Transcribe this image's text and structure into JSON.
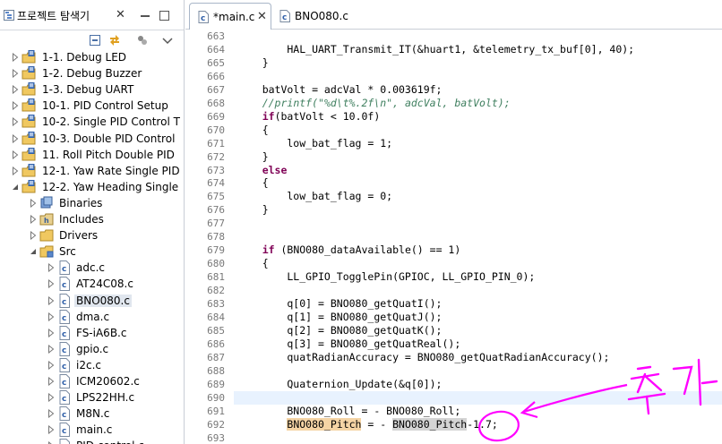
{
  "explorer": {
    "title": "프로젝트 탐색기",
    "close_glyph": "✕",
    "items": [
      {
        "label": "1-1. Debug LED",
        "depth": 0,
        "arrow": "right",
        "icon": "project-icon"
      },
      {
        "label": "1-2. Debug Buzzer",
        "depth": 0,
        "arrow": "right",
        "icon": "project-icon"
      },
      {
        "label": "1-3. Debug UART",
        "depth": 0,
        "arrow": "right",
        "icon": "project-icon"
      },
      {
        "label": "10-1. PID Control Setup",
        "depth": 0,
        "arrow": "right",
        "icon": "project-icon"
      },
      {
        "label": "10-2. Single PID Control T",
        "depth": 0,
        "arrow": "right",
        "icon": "project-icon"
      },
      {
        "label": "10-3. Double PID Control",
        "depth": 0,
        "arrow": "right",
        "icon": "project-icon"
      },
      {
        "label": "11. Roll Pitch Double PID",
        "depth": 0,
        "arrow": "right",
        "icon": "project-icon"
      },
      {
        "label": "12-1. Yaw Rate Single PID",
        "depth": 0,
        "arrow": "right",
        "icon": "project-icon"
      },
      {
        "label": "12-2. Yaw Heading Single",
        "depth": 0,
        "arrow": "down",
        "icon": "project-icon"
      },
      {
        "label": "Binaries",
        "depth": 1,
        "arrow": "right",
        "icon": "binaries-icon"
      },
      {
        "label": "Includes",
        "depth": 1,
        "arrow": "right",
        "icon": "includes-icon"
      },
      {
        "label": "Drivers",
        "depth": 1,
        "arrow": "right",
        "icon": "folder-icon"
      },
      {
        "label": "Src",
        "depth": 1,
        "arrow": "down",
        "icon": "source-folder-icon"
      },
      {
        "label": "adc.c",
        "depth": 2,
        "arrow": "right",
        "icon": "c-file-icon"
      },
      {
        "label": "AT24C08.c",
        "depth": 2,
        "arrow": "right",
        "icon": "c-file-icon"
      },
      {
        "label": "BNO080.c",
        "depth": 2,
        "arrow": "right",
        "icon": "c-file-icon",
        "selected": true
      },
      {
        "label": "dma.c",
        "depth": 2,
        "arrow": "right",
        "icon": "c-file-icon"
      },
      {
        "label": "FS-iA6B.c",
        "depth": 2,
        "arrow": "right",
        "icon": "c-file-icon"
      },
      {
        "label": "gpio.c",
        "depth": 2,
        "arrow": "right",
        "icon": "c-file-icon"
      },
      {
        "label": "i2c.c",
        "depth": 2,
        "arrow": "right",
        "icon": "c-file-icon"
      },
      {
        "label": "ICM20602.c",
        "depth": 2,
        "arrow": "right",
        "icon": "c-file-icon"
      },
      {
        "label": "LPS22HH.c",
        "depth": 2,
        "arrow": "right",
        "icon": "c-file-icon"
      },
      {
        "label": "M8N.c",
        "depth": 2,
        "arrow": "right",
        "icon": "c-file-icon"
      },
      {
        "label": "main.c",
        "depth": 2,
        "arrow": "right",
        "icon": "c-file-icon"
      },
      {
        "label": "PID control.c",
        "depth": 2,
        "arrow": "right",
        "icon": "c-file-icon"
      }
    ]
  },
  "editor": {
    "tabs": [
      {
        "label": "*main.c",
        "active": true,
        "close_glyph": "✕"
      },
      {
        "label": "BNO080.c",
        "active": false
      }
    ],
    "current_line": 690,
    "lines": [
      {
        "n": "663",
        "code": ""
      },
      {
        "n": "664",
        "code": "        HAL_UART_Transmit_IT(&huart1, &telemetry_tx_buf[0], 40);"
      },
      {
        "n": "665",
        "code": "    }"
      },
      {
        "n": "666",
        "code": ""
      },
      {
        "n": "667",
        "code": "    batVolt = adcVal * 0.003619f;"
      },
      {
        "n": "668",
        "code": "    //printf(\"%d\\t%.2f\\n\", adcVal, batVolt);"
      },
      {
        "n": "669",
        "code": "    if(batVolt < 10.0f)"
      },
      {
        "n": "670",
        "code": "    {"
      },
      {
        "n": "671",
        "code": "        low_bat_flag = 1;"
      },
      {
        "n": "672",
        "code": "    }"
      },
      {
        "n": "673",
        "code": "    else"
      },
      {
        "n": "674",
        "code": "    {"
      },
      {
        "n": "675",
        "code": "        low_bat_flag = 0;"
      },
      {
        "n": "676",
        "code": "    }"
      },
      {
        "n": "677",
        "code": ""
      },
      {
        "n": "678",
        "code": ""
      },
      {
        "n": "679",
        "code": "    if (BNO080_dataAvailable() == 1)"
      },
      {
        "n": "680",
        "code": "    {"
      },
      {
        "n": "681",
        "code": "        LL_GPIO_TogglePin(GPIOC, LL_GPIO_PIN_0);"
      },
      {
        "n": "682",
        "code": ""
      },
      {
        "n": "683",
        "code": "        q[0] = BNO080_getQuatI();"
      },
      {
        "n": "684",
        "code": "        q[1] = BNO080_getQuatJ();"
      },
      {
        "n": "685",
        "code": "        q[2] = BNO080_getQuatK();"
      },
      {
        "n": "686",
        "code": "        q[3] = BNO080_getQuatReal();"
      },
      {
        "n": "687",
        "code": "        quatRadianAccuracy = BNO080_getQuatRadianAccuracy();"
      },
      {
        "n": "688",
        "code": ""
      },
      {
        "n": "689",
        "code": "        Quaternion_Update(&q[0]);"
      },
      {
        "n": "690",
        "code": ""
      },
      {
        "n": "691",
        "code": "        BNO080_Roll = - BNO080_Roll;"
      },
      {
        "n": "692",
        "code": "        BNO080_Pitch = - BNO080_Pitch-1.7;"
      },
      {
        "n": "693",
        "code": ""
      }
    ]
  },
  "annotation": {
    "handwritten_text": "추가",
    "color": "#ff00ff"
  },
  "colors": {
    "keyword": "#7f0055",
    "comment": "#3f7f5f",
    "string": "#2a00ff",
    "current_line_bg": "#e8f2fe",
    "occurrence_highlight": "#f5d4a5"
  }
}
